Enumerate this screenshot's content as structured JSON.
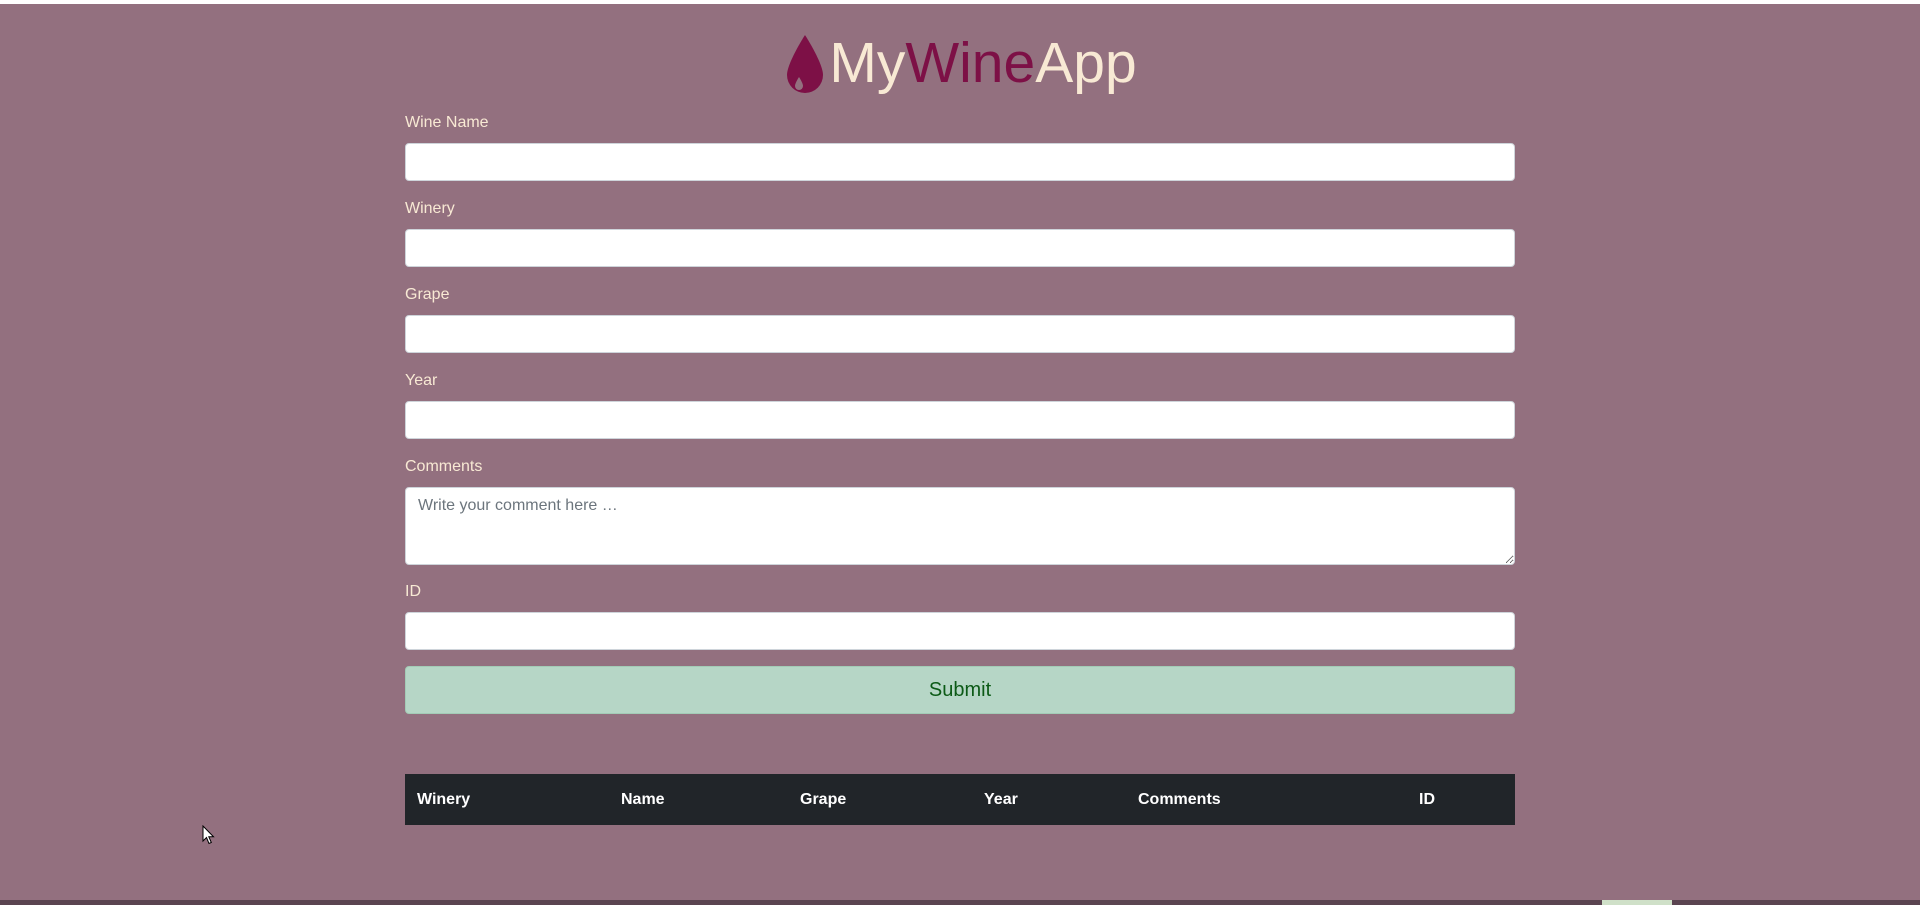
{
  "header": {
    "brand_my": "My",
    "brand_wine": "Wine",
    "brand_app": "App",
    "logo_icon": "wine-drop-icon"
  },
  "form": {
    "wine_name_label": "Wine Name",
    "wine_name_value": "",
    "winery_label": "Winery",
    "winery_value": "",
    "grape_label": "Grape",
    "grape_value": "",
    "year_label": "Year",
    "year_value": "",
    "comments_label": "Comments",
    "comments_placeholder": "Write your comment here …",
    "id_label": "ID",
    "id_value": "",
    "submit_label": "Submit"
  },
  "table": {
    "columns": [
      "Winery",
      "Name",
      "Grape",
      "Year",
      "Comments",
      "ID"
    ]
  },
  "colors": {
    "background": "#93707f",
    "brand_light": "#f8e9d4",
    "brand_wine": "#7d1046",
    "submit_bg": "#b6d6c6",
    "submit_text": "#0c5a16",
    "table_header_bg": "#212529"
  }
}
